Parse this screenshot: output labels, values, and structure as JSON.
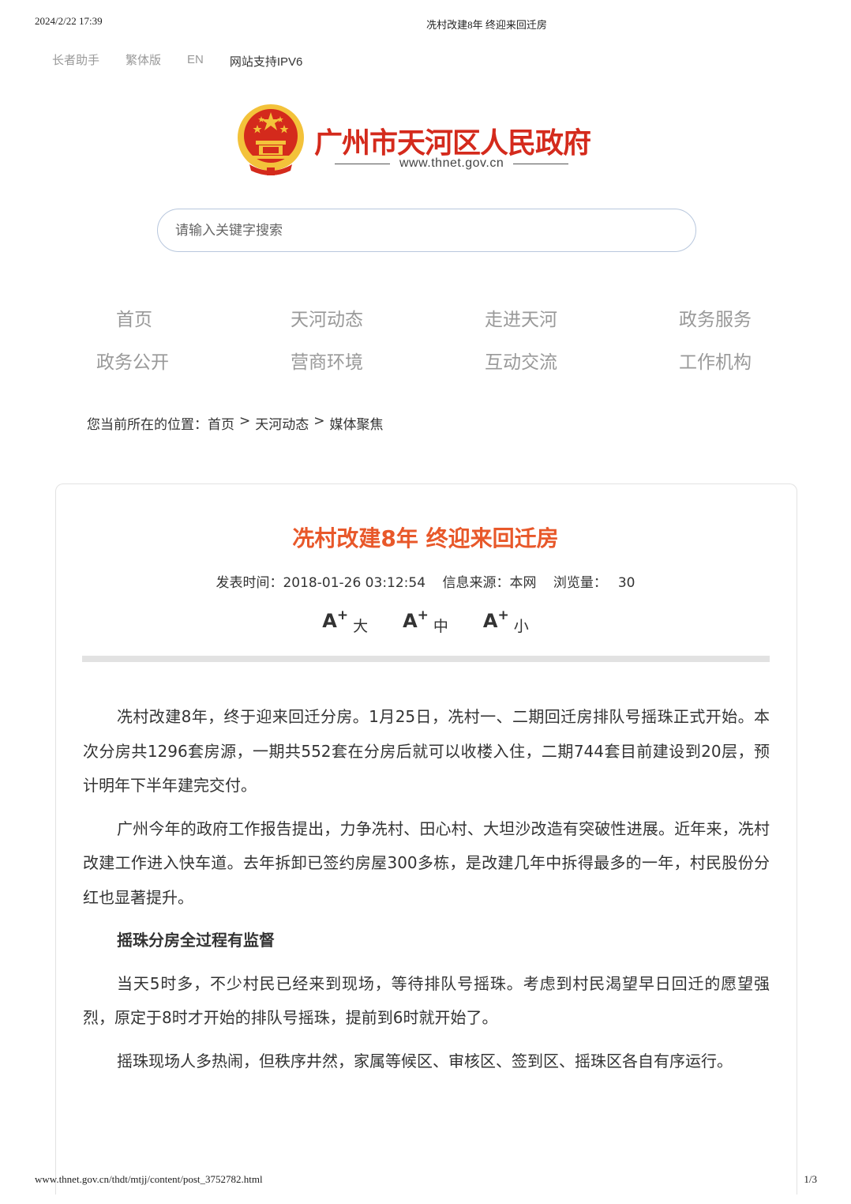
{
  "print_header": {
    "datetime": "2024/2/22 17:39",
    "title": "冼村改建8年 终迎来回迁房"
  },
  "topbar": {
    "elder": "长者助手",
    "traditional": "繁体版",
    "english": "EN",
    "ipv6": "网站支持IPV6"
  },
  "brand": {
    "name": "广州市天河区人民政府",
    "url": "www.thnet.gov.cn",
    "colors": {
      "red": "#d42a1c",
      "gold": "#f3c23a"
    }
  },
  "search": {
    "placeholder": "请输入关键字搜索"
  },
  "nav": {
    "items": [
      "首页",
      "天河动态",
      "走进天河",
      "政务服务",
      "政务公开",
      "营商环境",
      "互动交流",
      "工作机构"
    ]
  },
  "breadcrumb": {
    "prefix": "您当前所在的位置：",
    "items": [
      "首页",
      "天河动态",
      "媒体聚焦"
    ],
    "separator": ">"
  },
  "article": {
    "title": "冼村改建8年 终迎来回迁房",
    "publish_label": "发表时间：",
    "publish_time": "2018-01-26 03:12:54",
    "source_label": "信息来源：",
    "source": "本网",
    "views_label": "浏览量：",
    "views": "30",
    "font_sizes": [
      {
        "A": "A",
        "plus": "+",
        "label": "大"
      },
      {
        "A": "A",
        "plus": "+",
        "label": "中"
      },
      {
        "A": "A",
        "plus": "+",
        "label": "小"
      }
    ],
    "paragraphs": [
      "冼村改建8年，终于迎来回迁分房。1月25日，冼村一、二期回迁房排队号摇珠正式开始。本次分房共1296套房源，一期共552套在分房后就可以收楼入住，二期744套目前建设到20层，预计明年下半年建完交付。",
      "广州今年的政府工作报告提出，力争冼村、田心村、大坦沙改造有突破性进展。近年来，冼村改建工作进入快车道。去年拆卸已签约房屋300多栋，是改建几年中拆得最多的一年，村民股份分红也显著提升。",
      "摇珠分房全过程有监督",
      "当天5时多，不少村民已经来到现场，等待排队号摇珠。考虑到村民渴望早日回迁的愿望强烈，原定于8时才开始的排队号摇珠，提前到6时就开始了。",
      "摇珠现场人多热闹，但秩序井然，家属等候区、审核区、签到区、摇珠区各自有序运行。"
    ]
  },
  "print_footer": {
    "url": "www.thnet.gov.cn/thdt/mtjj/content/post_3752782.html",
    "page": "1/3"
  }
}
